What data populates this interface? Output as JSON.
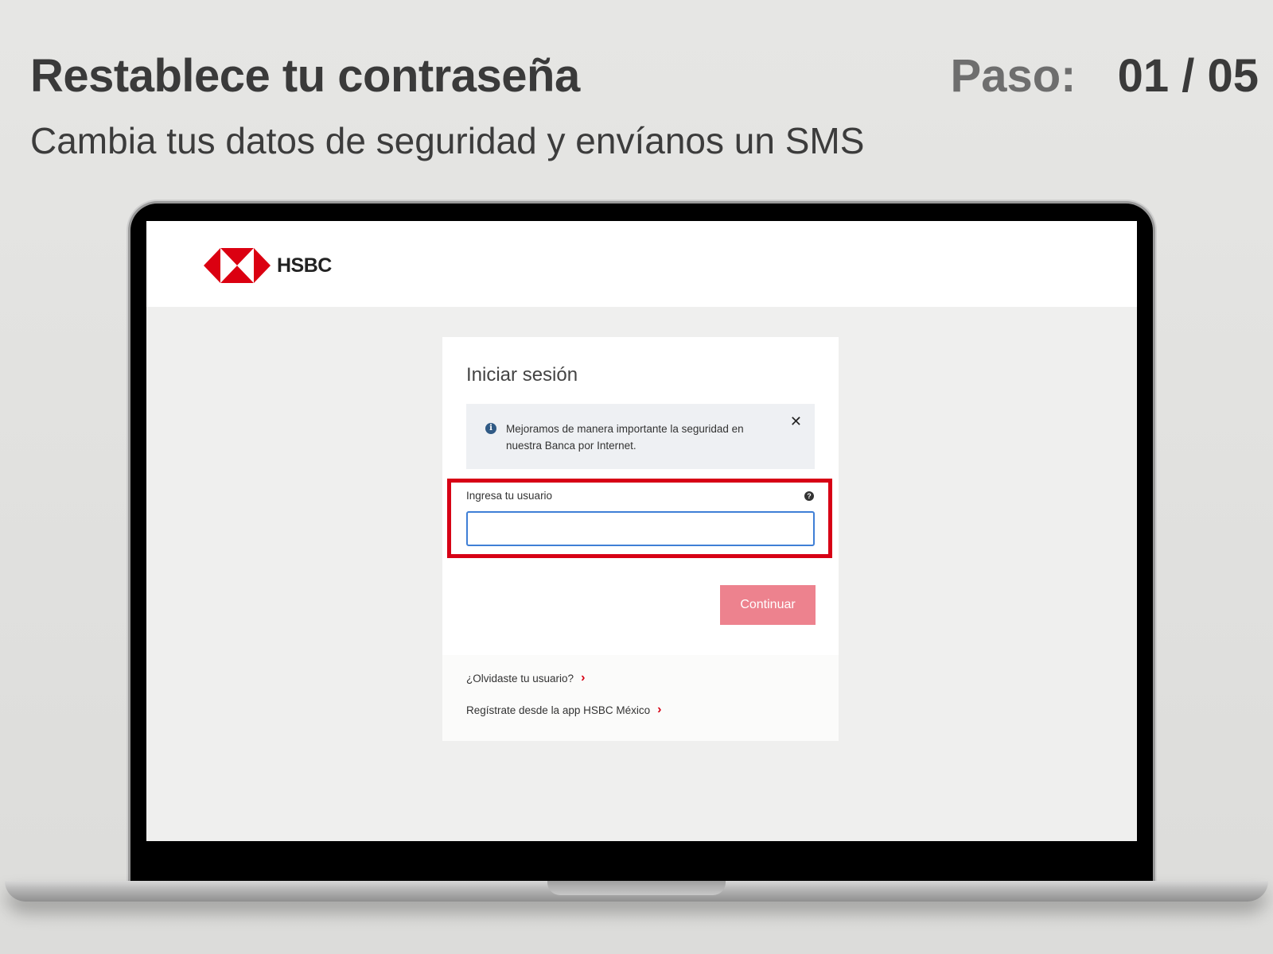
{
  "slide": {
    "title": "Restablece tu contraseña",
    "subtitle": "Cambia tus datos de seguridad y envíanos un SMS",
    "step_label": "Paso:",
    "step_value": "01 / 05"
  },
  "hsbc": {
    "brand_name": "HSBC",
    "brand_color": "#db0011",
    "login": {
      "title": "Iniciar sesión",
      "info_message": "Mejoramos de manera importante la seguridad en nuestra Banca por Internet.",
      "info_icon": "info-icon",
      "close_symbol": "✕",
      "username_label": "Ingresa tu usuario",
      "help_symbol": "?",
      "username_value": "",
      "continue_label": "Continuar",
      "highlight_color": "#d70015"
    },
    "links": {
      "forgot_user": "¿Olvidaste tu usuario?",
      "register_app": "Regístrate desde la app HSBC México",
      "chevron": "›"
    }
  }
}
